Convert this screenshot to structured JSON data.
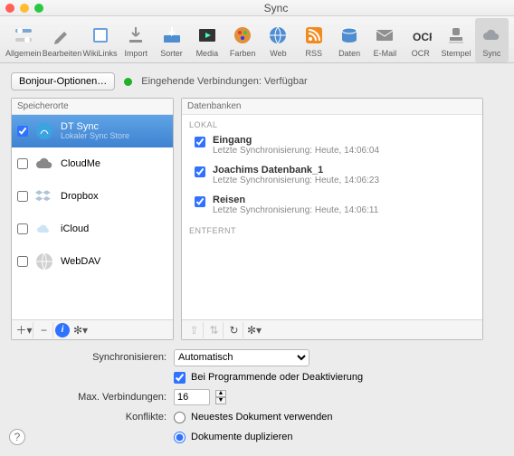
{
  "window": {
    "title": "Sync"
  },
  "toolbar": [
    {
      "id": "allgemein",
      "label": "Allgemein",
      "icon": "switches",
      "fill": "#7aa6d8"
    },
    {
      "id": "bearbeiten",
      "label": "Bearbeiten",
      "icon": "pencil",
      "fill": "#8f8f8f"
    },
    {
      "id": "wikilinks",
      "label": "WikiLinks",
      "icon": "book",
      "fill": "#6aa0dc"
    },
    {
      "id": "import",
      "label": "Import",
      "icon": "download",
      "fill": "#8f8f8f"
    },
    {
      "id": "sorter",
      "label": "Sorter",
      "icon": "tray",
      "fill": "#4f8dd1"
    },
    {
      "id": "media",
      "label": "Media",
      "icon": "media",
      "fill": "#4f8dd1"
    },
    {
      "id": "farben",
      "label": "Farben",
      "icon": "palette",
      "fill": "#e08f3a"
    },
    {
      "id": "web",
      "label": "Web",
      "icon": "globe",
      "fill": "#4f8dd1"
    },
    {
      "id": "rss",
      "label": "RSS",
      "icon": "rss",
      "fill": "#f28a1f"
    },
    {
      "id": "daten",
      "label": "Daten",
      "icon": "db",
      "fill": "#4f8dd1"
    },
    {
      "id": "email",
      "label": "E-Mail",
      "icon": "mail",
      "fill": "#8f8f8f"
    },
    {
      "id": "ocr",
      "label": "OCR",
      "icon": "ocr",
      "fill": "#333"
    },
    {
      "id": "stempel",
      "label": "Stempel",
      "icon": "stamp",
      "fill": "#8f8f8f"
    },
    {
      "id": "sync",
      "label": "Sync",
      "icon": "cloud",
      "fill": "#9aa0a6",
      "selected": true
    }
  ],
  "bonjour_btn": "Bonjour-Optionen…",
  "status_label": "Eingehende Verbindungen: Verfügbar",
  "panels": {
    "left_title": "Speicherorte",
    "right_title": "Datenbanken",
    "locations": [
      {
        "name": "DT Sync",
        "sub": "Lokaler Sync Store",
        "checked": true,
        "selected": true,
        "icon": "drive"
      },
      {
        "name": "CloudMe",
        "sub": "",
        "checked": false,
        "icon": "cloud"
      },
      {
        "name": "Dropbox",
        "sub": "",
        "checked": false,
        "icon": "dropbox"
      },
      {
        "name": "iCloud",
        "sub": "",
        "checked": false,
        "icon": "icloud"
      },
      {
        "name": "WebDAV",
        "sub": "",
        "checked": false,
        "icon": "webdav"
      }
    ],
    "section_local": "LOKAL",
    "section_remote": "ENTFERNT",
    "databases": [
      {
        "name": "Eingang",
        "sub": "Letzte Synchronisierung: Heute, 14:06:04",
        "checked": true
      },
      {
        "name": "Joachims Datenbank_1",
        "sub": "Letzte Synchronisierung: Heute, 14:06:23",
        "checked": true
      },
      {
        "name": "Reisen",
        "sub": "Letzte Synchronisierung: Heute, 14:06:11",
        "checked": true
      }
    ]
  },
  "left_footer_icons": [
    "plus",
    "minus",
    "info",
    "gear"
  ],
  "right_footer_icons": [
    "share",
    "sort",
    "refresh",
    "gear"
  ],
  "settings": {
    "sync_label": "Synchronisieren:",
    "sync_value": "Automatisch",
    "checkbox_label": "Bei Programmende oder Deaktivierung",
    "max_label": "Max. Verbindungen:",
    "max_value": "16",
    "conflict_label": "Konflikte:",
    "radio_newest": "Neuestes Dokument verwenden",
    "radio_dup": "Dokumente duplizieren",
    "radio_selected": "dup"
  }
}
